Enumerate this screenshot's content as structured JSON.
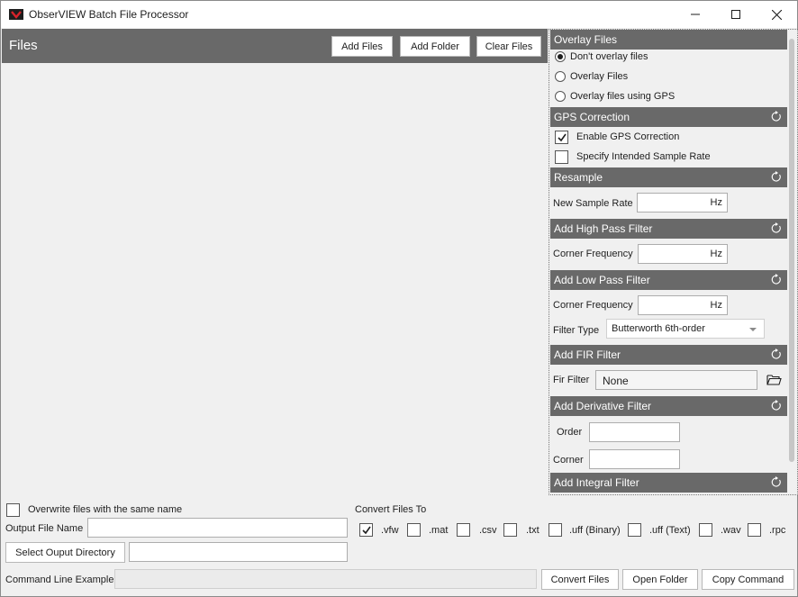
{
  "window": {
    "title": "ObserVIEW Batch File Processor",
    "icon": "obserview-logo-icon"
  },
  "files": {
    "title": "Files",
    "add_files": "Add Files",
    "add_folder": "Add Folder",
    "clear_files": "Clear Files"
  },
  "overlay": {
    "title": "Overlay Files",
    "options": [
      "Don't overlay files",
      "Overlay Files",
      "Overlay files using GPS"
    ],
    "selected": "Don't overlay files"
  },
  "gps": {
    "title": "GPS Correction",
    "enable_label": "Enable GPS Correction",
    "enable_checked": true,
    "intended_label": "Specify Intended Sample Rate",
    "intended_checked": false
  },
  "resample": {
    "title": "Resample",
    "rate_label": "New Sample Rate",
    "rate_value": "",
    "unit": "Hz"
  },
  "highpass": {
    "title": "Add High Pass Filter",
    "corner_label": "Corner Frequency",
    "corner_value": "",
    "unit": "Hz"
  },
  "lowpass": {
    "title": "Add Low Pass Filter",
    "corner_label": "Corner Frequency",
    "corner_value": "",
    "unit": "Hz",
    "type_label": "Filter Type",
    "type_value": "Butterworth 6th-order"
  },
  "fir": {
    "title": "Add FIR Filter",
    "label": "Fir Filter",
    "value": "None"
  },
  "derivative": {
    "title": "Add Derivative Filter",
    "order_label": "Order",
    "order_value": "",
    "corner_label": "Corner",
    "corner_value": ""
  },
  "integral": {
    "title": "Add Integral Filter"
  },
  "output": {
    "overwrite_label": "Overwrite files with the same name",
    "overwrite_checked": false,
    "name_label": "Output File Name",
    "name_value": "",
    "select_dir": "Select Ouput Directory",
    "dir_value": ""
  },
  "convert": {
    "label": "Convert Files To",
    "formats": [
      {
        "label": ".vfw",
        "checked": true
      },
      {
        "label": ".mat",
        "checked": false
      },
      {
        "label": ".csv",
        "checked": false
      },
      {
        "label": ".txt",
        "checked": false
      },
      {
        "label": ".uff (Binary)",
        "checked": false
      },
      {
        "label": ".uff (Text)",
        "checked": false
      },
      {
        "label": ".wav",
        "checked": false
      },
      {
        "label": ".rpc",
        "checked": false
      }
    ]
  },
  "command": {
    "label": "Command Line Example",
    "value": "",
    "convert_files": "Convert Files",
    "open_folder": "Open Folder",
    "copy_command": "Copy Command"
  },
  "colors": {
    "header": "#696969",
    "background": "#f0f0f0"
  }
}
